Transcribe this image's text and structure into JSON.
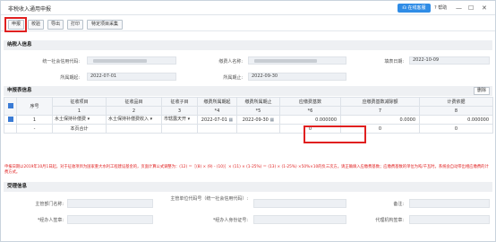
{
  "window": {
    "title": "非税收入通用申报",
    "online_btn": "在线客服",
    "help": "帮助",
    "minimize": "—",
    "restore": "☐",
    "close": "✕"
  },
  "toolbar": {
    "declare": "申报",
    "verify": "校验",
    "export": "导出",
    "print": "打印",
    "special_collect": "特定项目采集"
  },
  "taxpayer": {
    "section_title": "纳税人信息",
    "credit_code_label": "统一社会信用代码:",
    "name_label": "缴费人名称:",
    "fill_date_label": "填表日期:",
    "fill_date": "2022-10-09",
    "start_label": "所属期起:",
    "start": "2022-07-01",
    "end_label": "所属期止:",
    "end": "2022-09-30"
  },
  "declaration": {
    "section_title": "申报表信息",
    "delete_btn": "删除",
    "headers": [
      "序号",
      "征收项目",
      "征收品目",
      "征收子目",
      "缴费所属期起",
      "缴费所属期止",
      "应缴费基数",
      "应缴费基数减除额",
      "计费依据"
    ],
    "col_nums": [
      "1",
      "2",
      "3",
      "*4",
      "*5",
      "*6",
      "7",
      "8"
    ],
    "rows": [
      {
        "seq": "1",
        "item": "水土保持补偿费",
        "category": "水土保持补偿费收入",
        "subitem": "市辖露天开",
        "start": "2022-07-01",
        "end": "2022-09-30",
        "base": "0.000000",
        "deduction": "0.0000",
        "basis": "0.000000"
      },
      {
        "seq": "-",
        "label": "本页合计",
        "base": "0",
        "deduction": "0",
        "basis": "0"
      }
    ]
  },
  "note": "申报日期以2019年10月1日起，对于征收项目为国家重大水利工程建设基金的，页面计算公式调整为：(12) ＝［(8) × (9) - (10)］× (11) × (1-25%) ＝ (13) × (1-25%) ×50%×10的负三次方。请正确填入应缴费基数；应缴费基数的单位为吨/千瓦时。系统会自动带出相应缴费的计费方式。",
  "handler": {
    "section_title": "受理信息",
    "dept_label": "主管部门名称:",
    "unit_code_label": "主管单位代码号（统一社会信用代码）:",
    "remark_label": "备注:",
    "agent_label": "*经办人签章:",
    "agent_id_label": "*经办人身份证号:",
    "agency_label": "代理机构签章:"
  }
}
